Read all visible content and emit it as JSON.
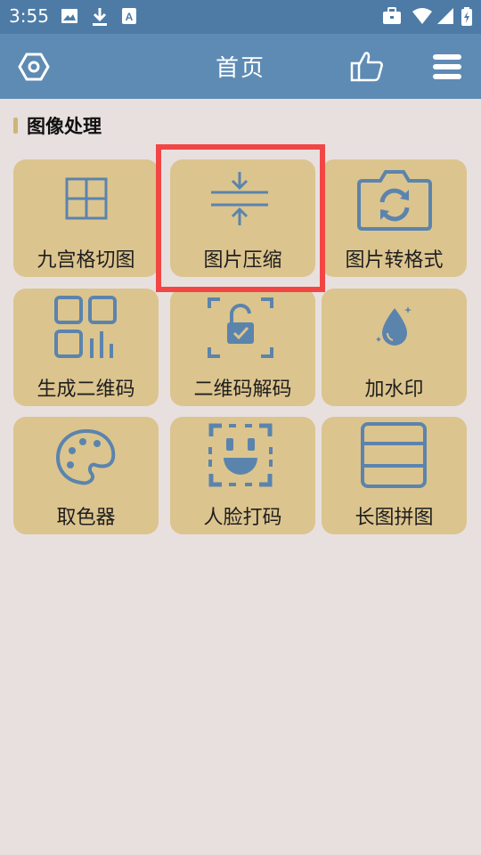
{
  "status_bar": {
    "time": "3:55",
    "left_icons": [
      "image-icon",
      "download-icon",
      "text-badge-icon"
    ],
    "right_icons": [
      "briefcase-icon",
      "wifi-icon",
      "signal-icon",
      "battery-icon"
    ]
  },
  "app_bar": {
    "title": "首页",
    "left_icon": "settings-hexagon-icon",
    "right_icons": [
      "thumbs-up-icon",
      "menu-icon"
    ],
    "background": "#5e8bb4"
  },
  "section": {
    "title": "图像处理"
  },
  "tiles": [
    {
      "label": "九宫格切图",
      "icon": "grid-icon"
    },
    {
      "label": "图片压缩",
      "icon": "compress-icon"
    },
    {
      "label": "图片转格式",
      "icon": "camera-rotate-icon"
    },
    {
      "label": "生成二维码",
      "icon": "qr-code-icon"
    },
    {
      "label": "二维码解码",
      "icon": "scan-unlock-icon"
    },
    {
      "label": "加水印",
      "icon": "water-drop-icon"
    },
    {
      "label": "取色器",
      "icon": "palette-icon"
    },
    {
      "label": "人脸打码",
      "icon": "face-scan-icon"
    },
    {
      "label": "长图拼图",
      "icon": "long-image-icon"
    }
  ],
  "colors": {
    "tile": "#dcc48e",
    "icon": "#5b84ad",
    "highlight": "#f24645",
    "page_background": "#e8e0df"
  }
}
